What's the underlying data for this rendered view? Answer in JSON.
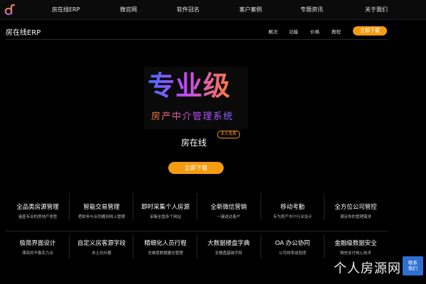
{
  "topnav": {
    "items": [
      "房在线ERP",
      "微官网",
      "软件冠名",
      "客户案例",
      "专题资讯",
      "关于我们"
    ]
  },
  "subheader": {
    "title": "房在线ERP",
    "links": [
      "概况",
      "功能",
      "价格",
      "教程"
    ],
    "cta": "立即下载"
  },
  "hero": {
    "headline": "专业级",
    "subtitle": "房产中介管理系统",
    "brand": "房在线",
    "badge": "永久免费",
    "cta": "立即下载"
  },
  "features": [
    {
      "title": "全品类房源管理",
      "desc": "涵盖专业的房地产类型"
    },
    {
      "title": "智能交易管理",
      "desc": "把财务与合同搬到线上管理"
    },
    {
      "title": "即时采集个人房源",
      "desc": "采集全国多个网站"
    },
    {
      "title": "全新微信营销",
      "desc": "一键送达客户"
    },
    {
      "title": "移动考勤",
      "desc": "专为房产中介行业设计"
    },
    {
      "title": "全方位公司管控",
      "desc": "满足你的管理需求"
    },
    {
      "title": "极简界面设计",
      "desc": "漂亮的不像实力派"
    },
    {
      "title": "自定义房客源字段",
      "desc": "本土化抖器"
    },
    {
      "title": "精细化人员行程",
      "desc": "全维度数据量化管理"
    },
    {
      "title": "大数据楼盘字典",
      "desc": "全楼盘基础字段"
    },
    {
      "title": "OA 办公协同",
      "desc": "公司效率成倍提"
    },
    {
      "title": "金融级数据安全",
      "desc": "微信支付核心技术"
    }
  ],
  "watermark": "个人房源网",
  "contact": {
    "line1": "联系",
    "line2": "我们"
  },
  "colors": {
    "accent": "#f39c12",
    "contact": "#2f6fd3",
    "background": "#000000"
  }
}
